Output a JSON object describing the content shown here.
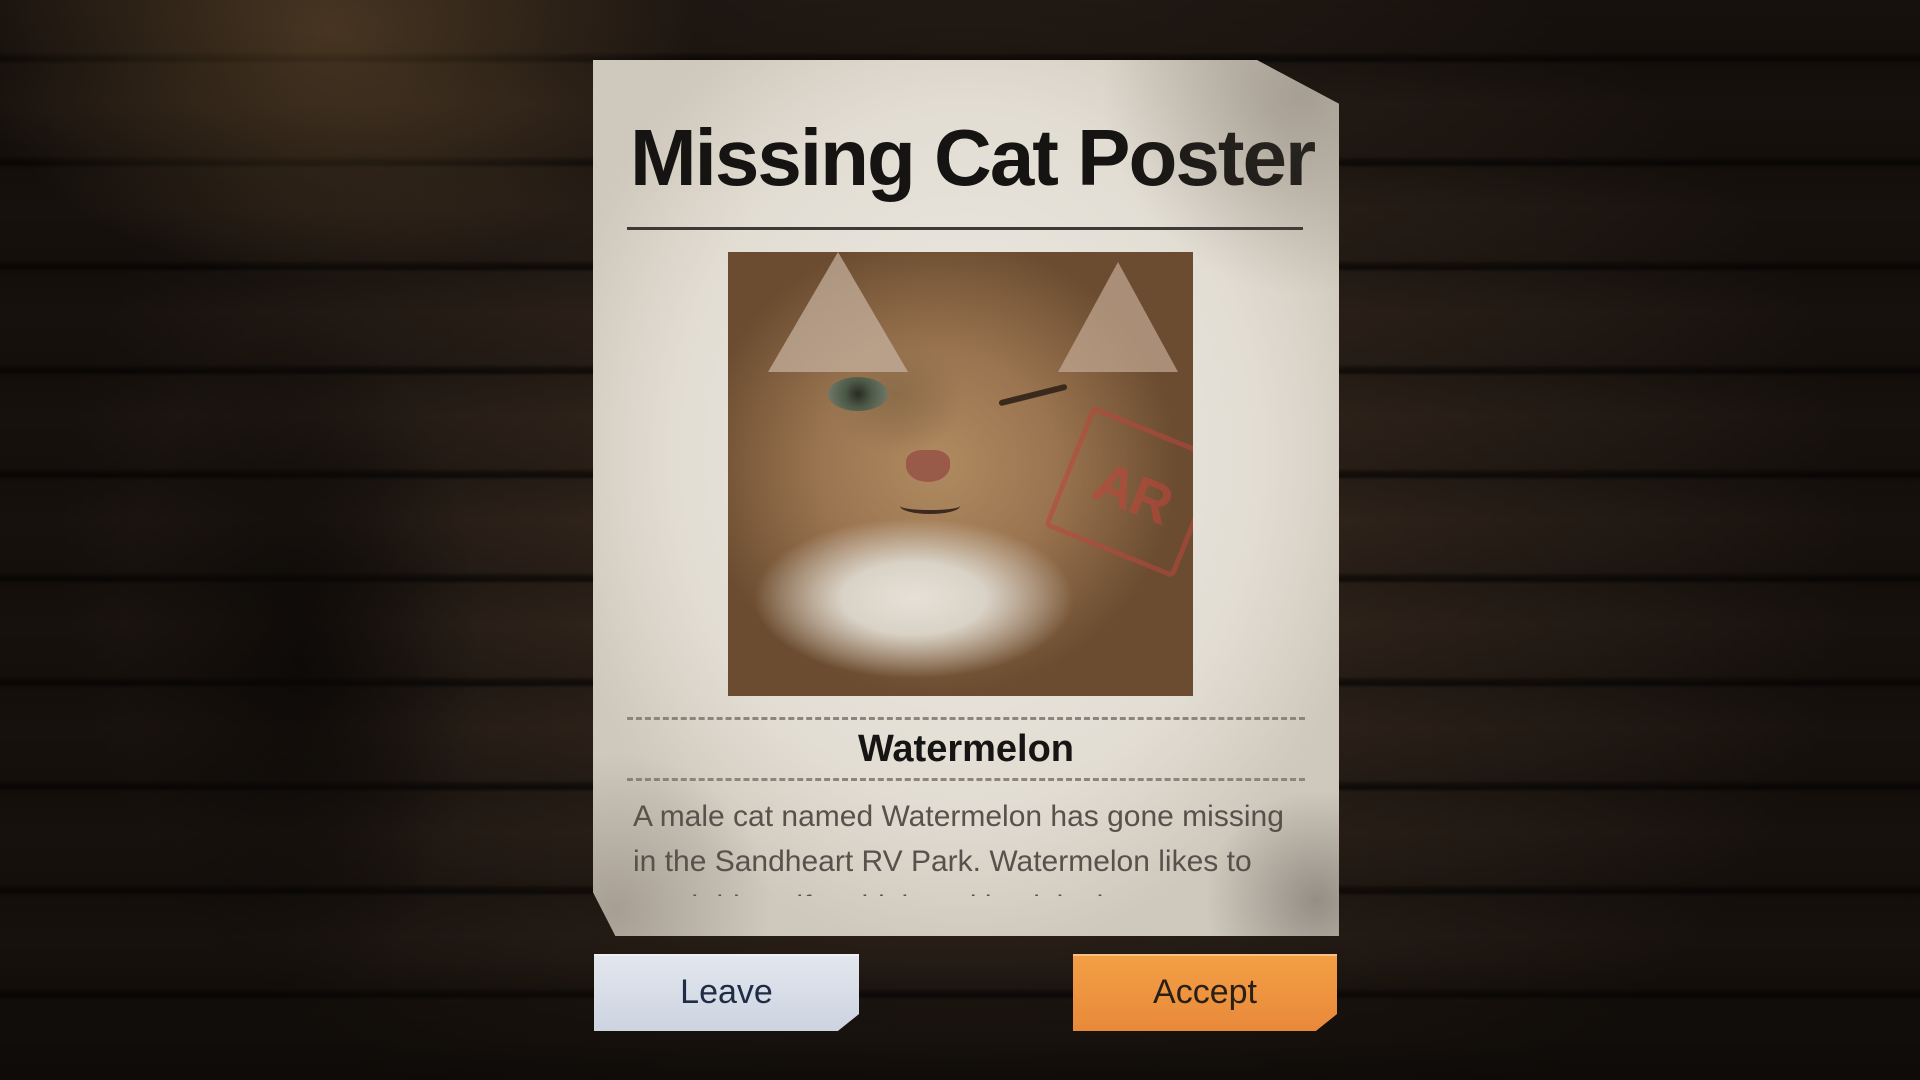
{
  "poster": {
    "title": "Missing Cat Poster",
    "stamp_text": "AR",
    "cat_name": "Watermelon",
    "description": "A male cat named Watermelon has gone missing in the Sandheart RV Park. Watermelon likes to perch himself up high and bask in the sun. Please"
  },
  "actions": {
    "leave_label": "Leave",
    "accept_label": "Accept"
  },
  "colors": {
    "accept_button": "#e8893a",
    "leave_button": "#d7dce6",
    "poster_paper": "#e6e2da"
  }
}
